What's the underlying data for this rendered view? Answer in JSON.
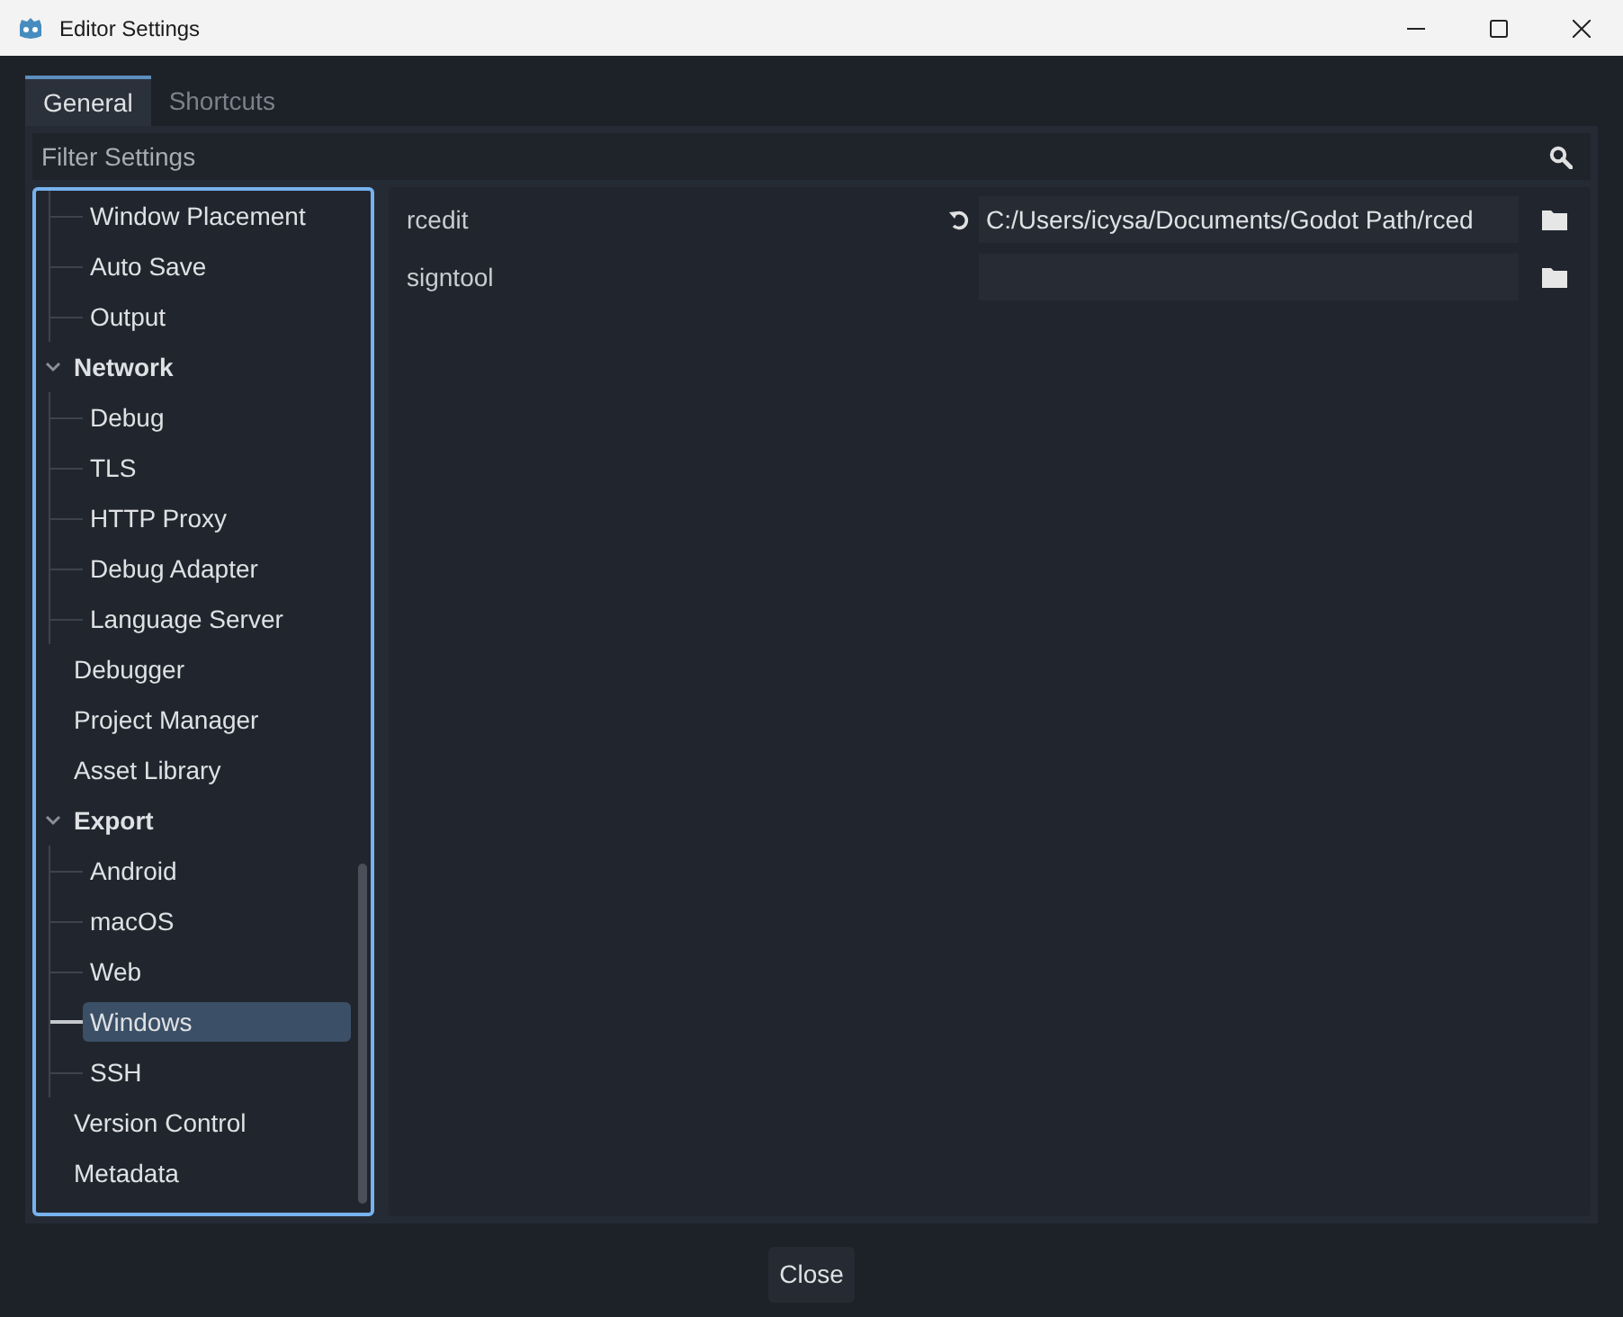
{
  "window": {
    "title": "Editor Settings"
  },
  "tabs": [
    {
      "label": "General",
      "selected": true
    },
    {
      "label": "Shortcuts",
      "selected": false
    }
  ],
  "filter": {
    "placeholder": "Filter Settings"
  },
  "tree": {
    "items": [
      {
        "children": [
          {
            "label": "Window Placement",
            "selected": false
          },
          {
            "label": "Auto Save",
            "selected": false
          },
          {
            "label": "Output",
            "selected": false
          }
        ]
      },
      {
        "label": "Network",
        "expanded": true,
        "selected": false,
        "children": [
          {
            "label": "Debug",
            "selected": false
          },
          {
            "label": "TLS",
            "selected": false
          },
          {
            "label": "HTTP Proxy",
            "selected": false
          },
          {
            "label": "Debug Adapter",
            "selected": false
          },
          {
            "label": "Language Server",
            "selected": false
          }
        ]
      },
      {
        "label": "Debugger",
        "selected": false
      },
      {
        "label": "Project Manager",
        "selected": false
      },
      {
        "label": "Asset Library",
        "selected": false
      },
      {
        "label": "Export",
        "expanded": true,
        "selected": false,
        "children": [
          {
            "label": "Android",
            "selected": false
          },
          {
            "label": "macOS",
            "selected": false
          },
          {
            "label": "Web",
            "selected": false
          },
          {
            "label": "Windows",
            "selected": true
          },
          {
            "label": "SSH",
            "selected": false
          }
        ]
      },
      {
        "label": "Version Control",
        "selected": false
      },
      {
        "label": "Metadata",
        "selected": false
      }
    ]
  },
  "properties": [
    {
      "name": "rcedit",
      "value": "C:/Users/icysa/Documents/Godot Path/rced",
      "revertable": true
    },
    {
      "name": "signtool",
      "revertable": false
    }
  ],
  "buttons": [
    {
      "label": "Close"
    }
  ]
}
